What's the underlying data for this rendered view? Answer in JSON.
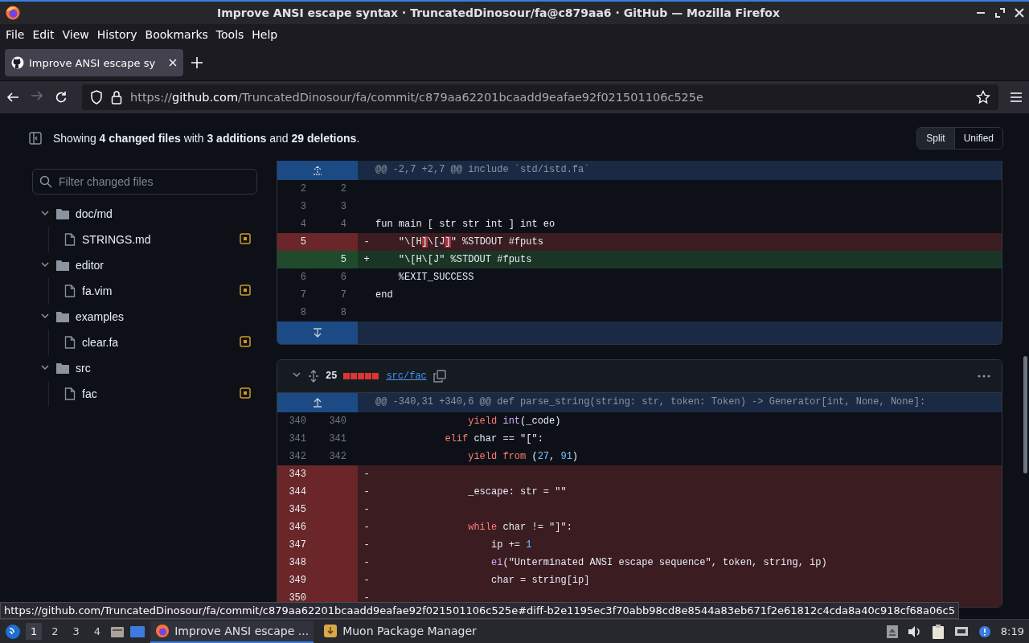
{
  "window": {
    "title": "Improve ANSI escape syntax · TruncatedDinosour/fa@c879aa6 · GitHub — Mozilla Firefox"
  },
  "menu": [
    "File",
    "Edit",
    "View",
    "History",
    "Bookmarks",
    "Tools",
    "Help"
  ],
  "tabs": [
    {
      "label": "Improve ANSI escape sy",
      "selected": true
    }
  ],
  "url": {
    "scheme": "https://",
    "host": "github.com",
    "path": "/TruncatedDinosour/fa/commit/c879aa62201bcaadd9eafae92f021501106c525e"
  },
  "nav": {
    "forward_disabled": true
  },
  "summary": "Showing **4 changed files** with **3 additions** and **29 deletions**.",
  "view_modes": [
    {
      "label": "Split",
      "selected": true
    },
    {
      "label": "Unified",
      "selected": false
    }
  ],
  "filter": {
    "placeholder": "Filter changed files"
  },
  "tree": [
    {
      "name": "doc/md",
      "expanded": true,
      "children": [
        {
          "name": "STRINGS.md",
          "modified": true
        }
      ]
    },
    {
      "name": "editor",
      "expanded": true,
      "children": [
        {
          "name": "fa.vim",
          "modified": true
        }
      ]
    },
    {
      "name": "examples",
      "expanded": true,
      "children": [
        {
          "name": "clear.fa",
          "modified": true
        }
      ]
    },
    {
      "name": "src",
      "expanded": true,
      "children": [
        {
          "name": "fac",
          "modified": true
        }
      ]
    }
  ],
  "diffs": [
    {
      "hunk": "@@ -2,7 +2,7 @@ include `std/istd.fa`",
      "lines": [
        {
          "old": "2",
          "new": "2",
          "kind": "context"
        },
        {
          "old": "3",
          "new": "3",
          "kind": "context"
        },
        {
          "old": "4",
          "new": "4",
          "kind": "context",
          "code": [
            {
              "text": "fun main [ str str int ] int eo",
              "kind": "plain"
            }
          ]
        },
        {
          "old": "5",
          "kind": "deleted",
          "sign": "-",
          "code": [
            {
              "text": "    \"\\[H",
              "kind": "plain"
            },
            {
              "text": "]",
              "kind": "changed"
            },
            {
              "text": "\\[J",
              "kind": "plain"
            },
            {
              "text": "]",
              "kind": "changed"
            },
            {
              "text": "\" %STDOUT #fputs",
              "kind": "plain"
            }
          ]
        },
        {
          "new": "5",
          "kind": "added",
          "sign": "+",
          "code": [
            {
              "text": "    \"\\[H\\[J\" %STDOUT #fputs",
              "kind": "plain"
            }
          ]
        },
        {
          "old": "6",
          "new": "6",
          "kind": "context",
          "code": [
            {
              "text": "    %EXIT_SUCCESS",
              "kind": "plain"
            }
          ]
        },
        {
          "old": "7",
          "new": "7",
          "kind": "context",
          "code": [
            {
              "text": "end",
              "kind": "plain"
            }
          ]
        },
        {
          "old": "8",
          "new": "8",
          "kind": "context"
        }
      ],
      "expand_below": true
    },
    {
      "file": {
        "count": "25",
        "diffstat": [
          {
            "kind": "deleted"
          },
          {
            "kind": "deleted"
          },
          {
            "kind": "deleted"
          },
          {
            "kind": "deleted"
          },
          {
            "kind": "deleted"
          }
        ],
        "path": "src/fac",
        "expanded": true
      },
      "hunk": "@@ -340,31 +340,6 @@ def parse_string(string: str, token: Token) -> Generator[int, None, None]:",
      "lines": [
        {
          "old": "340",
          "new": "340",
          "kind": "context",
          "code": [
            {
              "text": "                yield ",
              "kind": "keyword"
            },
            {
              "text": "int",
              "kind": "builtin"
            },
            {
              "text": "(_code)",
              "kind": "plain"
            }
          ]
        },
        {
          "old": "341",
          "new": "341",
          "kind": "context",
          "code": [
            {
              "text": "            elif",
              "kind": "keyword"
            },
            {
              "text": " char == \"[\":",
              "kind": "plain"
            }
          ]
        },
        {
          "old": "342",
          "new": "342",
          "kind": "context",
          "code": [
            {
              "text": "                yield from",
              "kind": "keyword"
            },
            {
              "text": " (",
              "kind": "plain"
            },
            {
              "text": "27",
              "kind": "number"
            },
            {
              "text": ", ",
              "kind": "plain"
            },
            {
              "text": "91",
              "kind": "number"
            },
            {
              "text": ")",
              "kind": "plain"
            }
          ]
        },
        {
          "old": "343",
          "kind": "deleted",
          "sign": "-"
        },
        {
          "old": "344",
          "kind": "deleted",
          "sign": "-",
          "code": [
            {
              "text": "                _escape: str = \"\"",
              "kind": "plain"
            }
          ]
        },
        {
          "old": "345",
          "kind": "deleted",
          "sign": "-"
        },
        {
          "old": "346",
          "kind": "deleted",
          "sign": "-",
          "code": [
            {
              "text": "                while",
              "kind": "keyword"
            },
            {
              "text": " char != \"]\":",
              "kind": "plain"
            }
          ]
        },
        {
          "old": "347",
          "kind": "deleted",
          "sign": "-",
          "code": [
            {
              "text": "                    ip += ",
              "kind": "plain"
            },
            {
              "text": "1",
              "kind": "number"
            }
          ]
        },
        {
          "old": "348",
          "kind": "deleted",
          "sign": "-",
          "code": [
            {
              "text": "                    ei",
              "kind": "builtin"
            },
            {
              "text": "(\"Unterminated ANSI escape sequence\", token, string, ip)",
              "kind": "plain"
            }
          ]
        },
        {
          "old": "349",
          "kind": "deleted",
          "sign": "-",
          "code": [
            {
              "text": "                    char = string[ip]",
              "kind": "plain"
            }
          ]
        },
        {
          "old": "350",
          "kind": "deleted",
          "sign": "-"
        }
      ]
    }
  ],
  "status_url": "https://github.com/TruncatedDinosour/fa/commit/c879aa62201bcaadd9eafae92f021501106c525e#diff-b2e1195ec3f70abb98cd8e8544a83eb671f2e61812c4cda8a40c918cf68a06c5",
  "taskbar": {
    "workspaces": [
      {
        "label": "1",
        "selected": true
      },
      {
        "label": "2",
        "selected": false
      },
      {
        "label": "3",
        "selected": false
      },
      {
        "label": "4",
        "selected": false
      }
    ],
    "tasks": [
      {
        "label": "Improve ANSI escape ...",
        "selected": true
      },
      {
        "label": "Muon Package Manager",
        "selected": false
      }
    ],
    "clock": "8:19"
  }
}
